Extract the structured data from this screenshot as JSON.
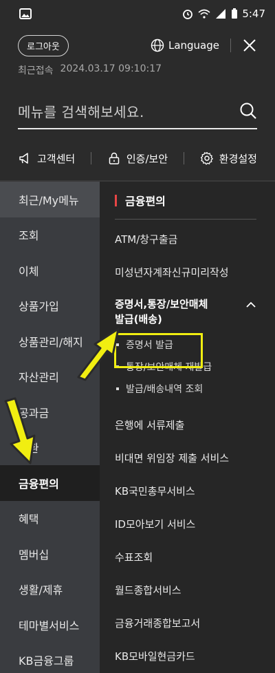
{
  "status_bar": {
    "time": "5:47"
  },
  "header": {
    "logout_label": "로그아웃",
    "language_label": "Language",
    "last_access_label": "최근접속",
    "last_access_time": "2024.03.17 09:10:17"
  },
  "search": {
    "placeholder": "메뉴를 검색해보세요."
  },
  "quick_links": [
    {
      "label": "고객센터",
      "icon": "megaphone-icon"
    },
    {
      "label": "인증/보안",
      "icon": "lock-icon"
    },
    {
      "label": "환경설정",
      "icon": "gear-icon"
    }
  ],
  "left_nav": {
    "items": [
      {
        "label": "최근/My메뉴"
      },
      {
        "label": "조회"
      },
      {
        "label": "이체"
      },
      {
        "label": "상품가입"
      },
      {
        "label": "상품관리/해지"
      },
      {
        "label": "자산관리"
      },
      {
        "label": "공과금"
      },
      {
        "label": "외환"
      },
      {
        "label": "금융편의"
      },
      {
        "label": "혜택"
      },
      {
        "label": "멤버십"
      },
      {
        "label": "생활/제휴"
      },
      {
        "label": "테마별서비스"
      },
      {
        "label": "KB금융그룹"
      }
    ],
    "active_label": "금융편의"
  },
  "content": {
    "title": "금융편의",
    "items_top": [
      "ATM/창구출금",
      "미성년자계좌신규미리작성"
    ],
    "group": {
      "title_line1": "증명서,통장/보안매체",
      "title_line2": "발급(배송)",
      "subitems": [
        "증명서 발급",
        "통장/보안매체 재발급",
        "발급/배송내역 조회"
      ]
    },
    "items_bottom": [
      "은행에 서류제출",
      "비대면 위임장 제출 서비스",
      "KB국민총무서비스",
      "ID모아보기 서비스",
      "수표조회",
      "월드종합서비스",
      "금융거래종합보고서",
      "KB모바일현금카드"
    ]
  },
  "colors": {
    "accent_red": "#e84545",
    "highlight_yellow": "#f1ee11"
  }
}
